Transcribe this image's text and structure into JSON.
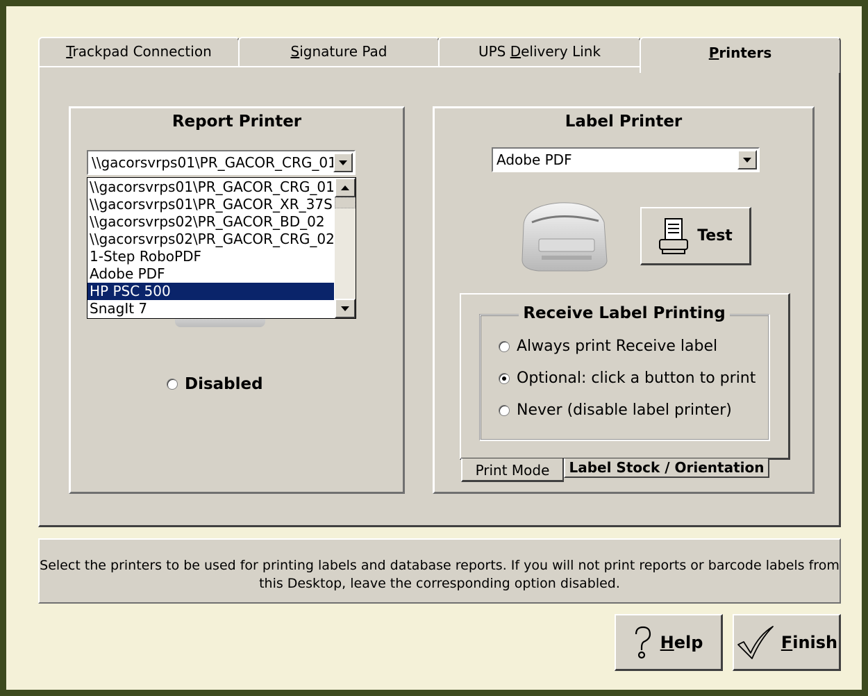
{
  "tabs": [
    {
      "pre": "",
      "mnemonic": "T",
      "post": "rackpad Connection"
    },
    {
      "pre": "",
      "mnemonic": "S",
      "post": "ignature Pad"
    },
    {
      "pre": "UPS ",
      "mnemonic": "D",
      "post": "elivery Link"
    },
    {
      "pre": "",
      "mnemonic": "P",
      "post": "rinters"
    }
  ],
  "report_printer": {
    "title": "Report Printer",
    "selected": "\\\\gacorsvrps01\\PR_GACOR_CRG_01",
    "options": [
      "\\\\gacorsvrps01\\PR_GACOR_CRG_01",
      "\\\\gacorsvrps01\\PR_GACOR_XR_37S",
      "\\\\gacorsvrps02\\PR_GACOR_BD_02",
      "\\\\gacorsvrps02\\PR_GACOR_CRG_02",
      "1-Step RoboPDF",
      "Adobe PDF",
      "HP PSC 500",
      "SnagIt 7"
    ],
    "highlighted": "HP PSC 500",
    "disabled_label": "Disabled"
  },
  "label_printer": {
    "title": "Label Printer",
    "selected": "Adobe PDF",
    "test_label": "Test",
    "receive_group": {
      "title": "Receive Label Printing",
      "options": [
        {
          "label": "Always print Receive label",
          "checked": false
        },
        {
          "label": "Optional: click a button to print",
          "checked": true
        },
        {
          "label": "Never (disable label printer)",
          "checked": false
        }
      ]
    },
    "subtabs": [
      "Print Mode",
      "Label Stock / Orientation"
    ]
  },
  "status": {
    "line1": "Select the printers to be used for printing labels and database reports.  If you will not print reports or barcode labels from",
    "line2": "this Desktop, leave the corresponding option disabled."
  },
  "buttons": {
    "help": {
      "mnemonic": "H",
      "rest": "elp"
    },
    "finish": {
      "mnemonic": "F",
      "rest": "inish"
    }
  }
}
